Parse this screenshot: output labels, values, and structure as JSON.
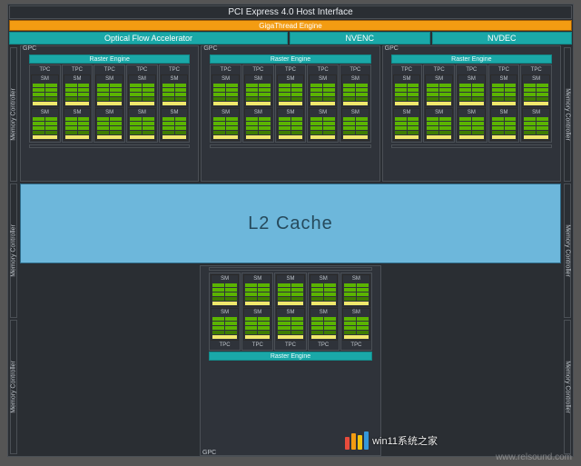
{
  "pci_label": "PCI Express 4.0 Host Interface",
  "giga_label": "GigaThread Engine",
  "encoders": {
    "ofa": "Optical Flow Accelerator",
    "nvenc": "NVENC",
    "nvdec": "NVDEC"
  },
  "mem_label": "Memory Controller",
  "mem_left_count": 3,
  "mem_right_count": 3,
  "gpc_label": "GPC",
  "raster_label": "Raster Engine",
  "tpc_label": "TPC",
  "sm_label": "SM",
  "l2_label": "L2 Cache",
  "colors": {
    "sm_green": "#5bb400",
    "sm_dark_green": "#3f7d00",
    "sm_yellow": "#f0e86c",
    "teal": "#1aa8a8",
    "l2": "#6db7db",
    "orange": "#f39c12"
  },
  "top_gpc_count": 3,
  "tpc_per_top_gpc": 5,
  "tpc_per_bottom_gpc": 5,
  "sm_per_tpc": 2,
  "watermarks": {
    "site1": "win11系统之家",
    "site2": "www.relsound.com"
  }
}
